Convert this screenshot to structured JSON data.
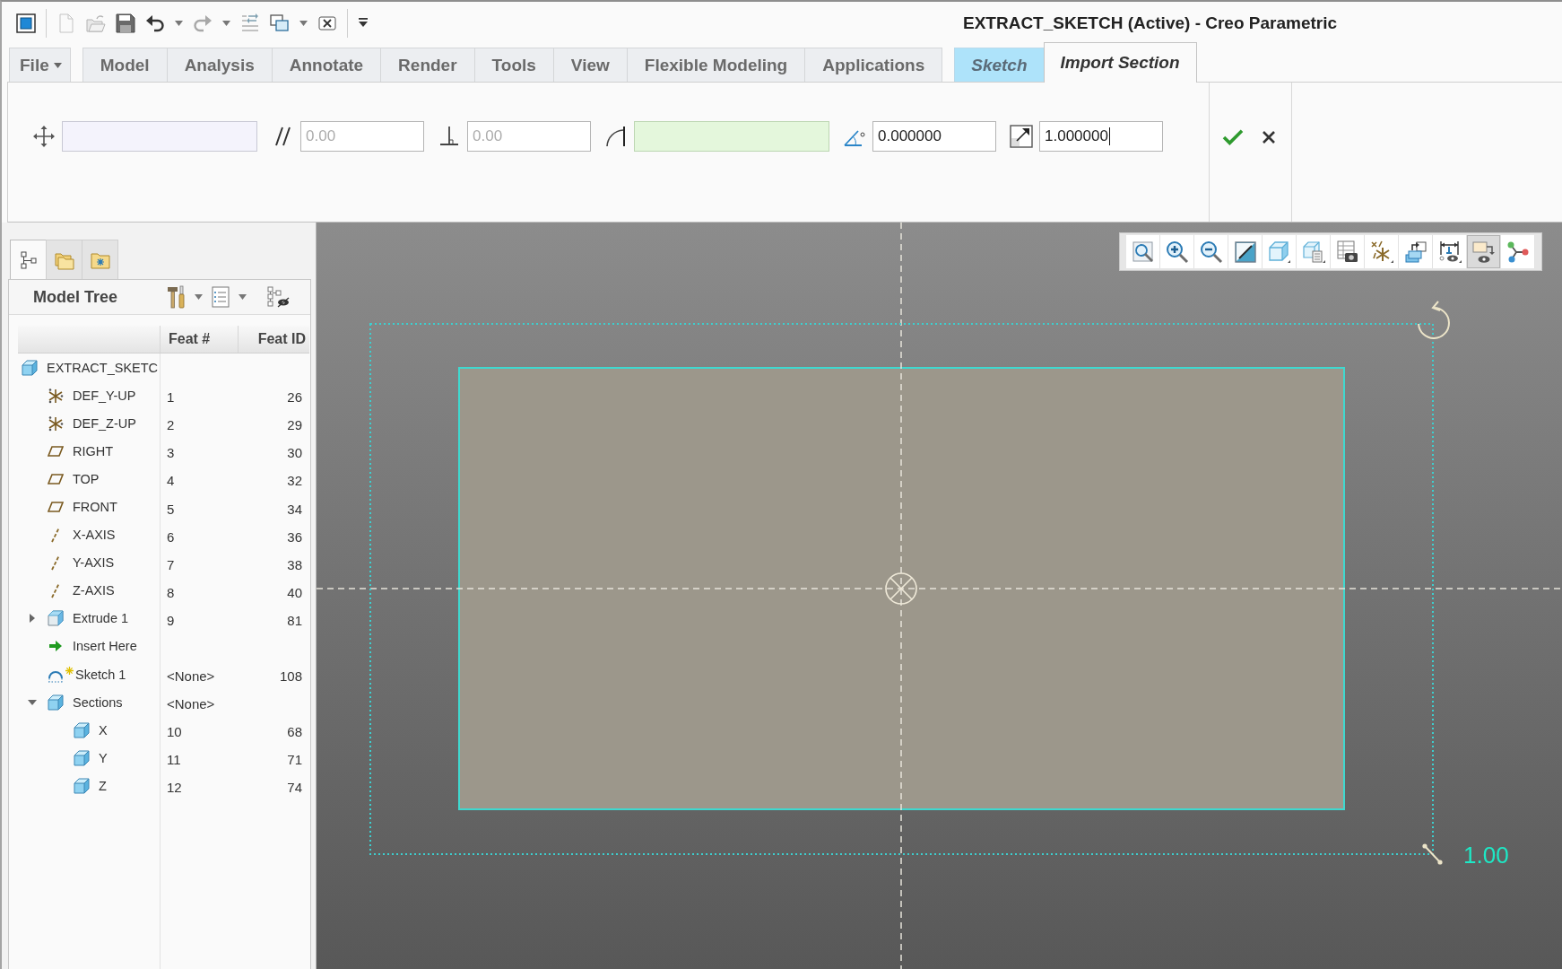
{
  "window": {
    "title": "EXTRACT_SKETCH (Active) - Creo Parametric"
  },
  "ribbon": {
    "tabs": [
      {
        "label": "File",
        "kind": "menu",
        "selected": false
      },
      {
        "label": "Model",
        "kind": "standard",
        "selected": false
      },
      {
        "label": "Analysis",
        "kind": "standard",
        "selected": false
      },
      {
        "label": "Annotate",
        "kind": "standard",
        "selected": false
      },
      {
        "label": "Render",
        "kind": "standard",
        "selected": false
      },
      {
        "label": "Tools",
        "kind": "standard",
        "selected": false
      },
      {
        "label": "View",
        "kind": "standard",
        "selected": false
      },
      {
        "label": "Flexible Modeling",
        "kind": "standard",
        "selected": false
      },
      {
        "label": "Applications",
        "kind": "standard",
        "selected": false
      },
      {
        "label": "Sketch",
        "kind": "contextual",
        "selected": false
      },
      {
        "label": "Import Section",
        "kind": "contextual",
        "selected": true
      }
    ],
    "fields": [
      {
        "kind": "collector",
        "active": false
      },
      {
        "kind": "number",
        "value": "0.00",
        "disabled": true,
        "focused": false
      },
      {
        "kind": "number",
        "value": "0.00",
        "disabled": true,
        "focused": false
      },
      {
        "kind": "collector",
        "active": true
      },
      {
        "kind": "number",
        "value": "0.000000",
        "disabled": false,
        "focused": false
      },
      {
        "kind": "number",
        "value": "1.000000",
        "disabled": false,
        "focused": true
      }
    ]
  },
  "model_tree": {
    "panel_tabs": [
      {
        "selected": true
      },
      {
        "selected": false
      },
      {
        "selected": false
      }
    ],
    "title": "Model Tree",
    "columns": [
      "Feat #",
      "Feat ID"
    ],
    "nodes": [
      {
        "kind": "part",
        "label": "EXTRACT_SKETC",
        "children": [
          {
            "kind": "csys",
            "label": "DEF_Y-UP",
            "feat_no": "1",
            "feat_id": "26"
          },
          {
            "kind": "csys",
            "label": "DEF_Z-UP",
            "feat_no": "2",
            "feat_id": "29"
          },
          {
            "kind": "datum_plane",
            "label": "RIGHT",
            "feat_no": "3",
            "feat_id": "30"
          },
          {
            "kind": "datum_plane",
            "label": "TOP",
            "feat_no": "4",
            "feat_id": "32"
          },
          {
            "kind": "datum_plane",
            "label": "FRONT",
            "feat_no": "5",
            "feat_id": "34"
          },
          {
            "kind": "datum_axis",
            "label": "X-AXIS",
            "feat_no": "6",
            "feat_id": "36"
          },
          {
            "kind": "datum_axis",
            "label": "Y-AXIS",
            "feat_no": "7",
            "feat_id": "38"
          },
          {
            "kind": "datum_axis",
            "label": "Z-AXIS",
            "feat_no": "8",
            "feat_id": "40"
          },
          {
            "kind": "extrude",
            "label": "Extrude 1",
            "feat_no": "9",
            "feat_id": "81",
            "expanded": false
          },
          {
            "kind": "insert",
            "label": "Insert Here"
          },
          {
            "kind": "sketch",
            "label": "Sketch 1",
            "feat_no": "<None>",
            "feat_id": "108"
          },
          {
            "kind": "section_group",
            "label": "Sections",
            "feat_no": "<None>",
            "expanded": true,
            "children": [
              {
                "kind": "section",
                "label": "X",
                "feat_no": "10",
                "feat_id": "68"
              },
              {
                "kind": "section",
                "label": "Y",
                "feat_no": "11",
                "feat_id": "71"
              },
              {
                "kind": "section",
                "label": "Z",
                "feat_no": "12",
                "feat_id": "74"
              }
            ]
          }
        ]
      }
    ]
  },
  "view_toolbar": {
    "buttons": [
      {
        "on": false
      },
      {
        "on": false
      },
      {
        "on": false
      },
      {
        "on": false
      },
      {
        "on": false
      },
      {
        "on": false
      },
      {
        "on": false
      },
      {
        "on": false
      },
      {
        "on": false
      },
      {
        "on": false
      },
      {
        "on": true
      },
      {
        "on": false
      }
    ]
  },
  "canvas": {
    "scale_reading": "1.00"
  }
}
